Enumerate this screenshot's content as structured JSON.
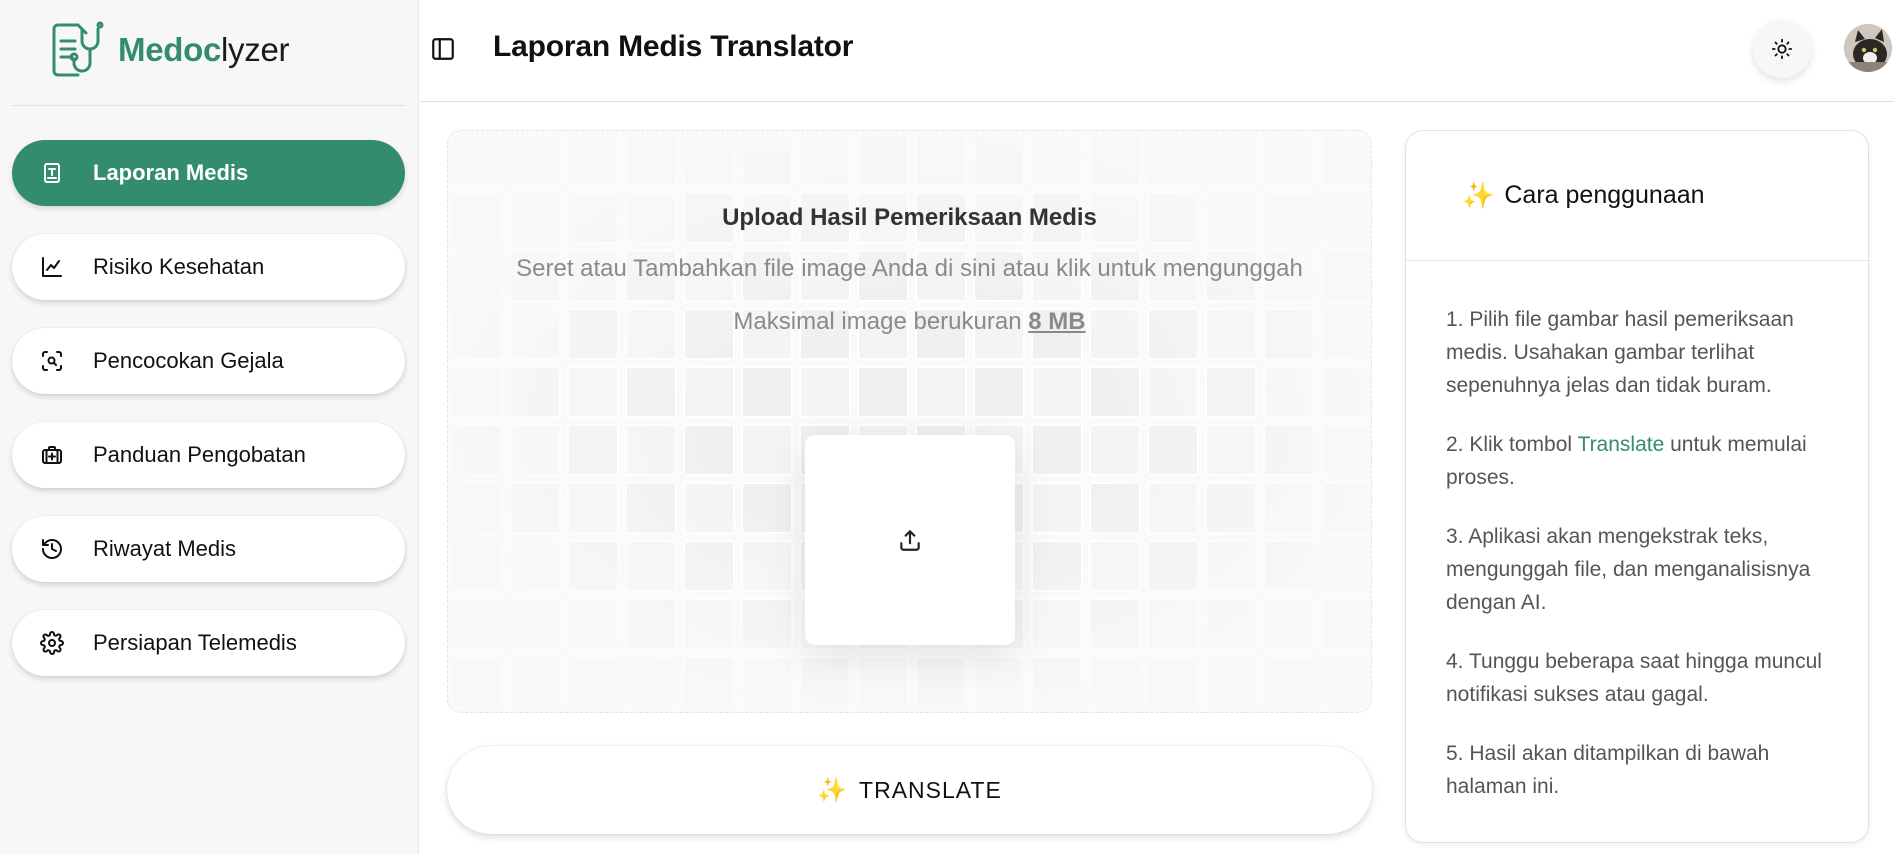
{
  "brand": {
    "name_accent": "Medoc",
    "name_rest": "lyzer"
  },
  "sidebar": {
    "items": [
      {
        "label": "Laporan Medis",
        "icon": "medical-report-icon",
        "active": true
      },
      {
        "label": "Risiko Kesehatan",
        "icon": "line-chart-icon",
        "active": false
      },
      {
        "label": "Pencocokan Gejala",
        "icon": "scan-search-icon",
        "active": false
      },
      {
        "label": "Panduan Pengobatan",
        "icon": "medical-kit-icon",
        "active": false
      },
      {
        "label": "Riwayat Medis",
        "icon": "history-icon",
        "active": false
      },
      {
        "label": "Persiapan Telemedis",
        "icon": "gear-icon",
        "active": false
      }
    ]
  },
  "header": {
    "title": "Laporan Medis Translator"
  },
  "upload": {
    "title": "Upload Hasil Pemeriksaan Medis",
    "subtitle": "Seret atau Tambahkan file image Anda di sini atau klik untuk mengunggah",
    "max_prefix": "Maksimal image berukuran ",
    "max_size": "8 MB"
  },
  "translate_button": {
    "label": "TRANSLATE"
  },
  "help": {
    "title": "Cara penggunaan",
    "steps": [
      {
        "text": "1. Pilih file gambar hasil pemeriksaan medis. Usahakan gambar terlihat sepenuhnya jelas dan tidak buram."
      },
      {
        "before": "2. Klik tombol ",
        "highlight": "Translate",
        "after": " untuk memulai proses."
      },
      {
        "text": "3. Aplikasi akan mengekstrak teks, mengunggah file, dan menganalisisnya dengan AI."
      },
      {
        "text": "4. Tunggu beberapa saat hingga muncul notifikasi sukses atau gagal."
      },
      {
        "text": "5. Hasil akan ditampilkan di bawah halaman ini."
      }
    ]
  },
  "colors": {
    "accent": "#338d6c",
    "spark": "#f2a23a"
  }
}
